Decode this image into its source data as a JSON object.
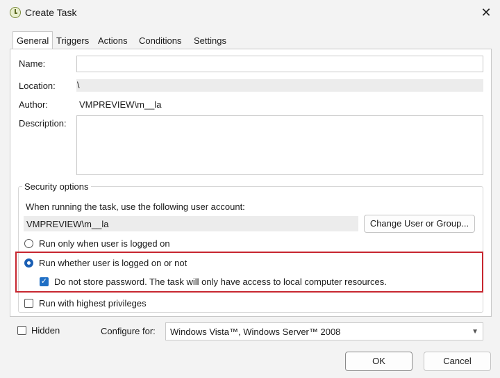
{
  "window": {
    "title": "Create Task",
    "close_glyph": "✕"
  },
  "tabs": [
    "General",
    "Triggers",
    "Actions",
    "Conditions",
    "Settings"
  ],
  "general": {
    "name_label": "Name:",
    "name_value": "",
    "location_label": "Location:",
    "location_value": "\\",
    "author_label": "Author:",
    "author_value": "VMPREVIEW\\m__la",
    "description_label": "Description:",
    "description_value": ""
  },
  "security": {
    "legend": "Security options",
    "account_prompt": "When running the task, use the following user account:",
    "account_value": "VMPREVIEW\\m__la",
    "change_button": "Change User or Group...",
    "radio_logged_on": "Run only when user is logged on",
    "radio_whether": "Run whether user is logged on or not",
    "selected_radio": "whether",
    "do_not_store_password": "Do not store password.  The task will only have access to local computer resources.",
    "do_not_store_checked": true,
    "highest_privileges": "Run with highest privileges",
    "highest_checked": false
  },
  "footer": {
    "hidden_label": "Hidden",
    "hidden_checked": false,
    "configure_label": "Configure for:",
    "configure_value": "Windows Vista™, Windows Server™ 2008",
    "ok": "OK",
    "cancel": "Cancel"
  },
  "colors": {
    "highlight": "#c7262f",
    "accent": "#1f6fc5"
  }
}
